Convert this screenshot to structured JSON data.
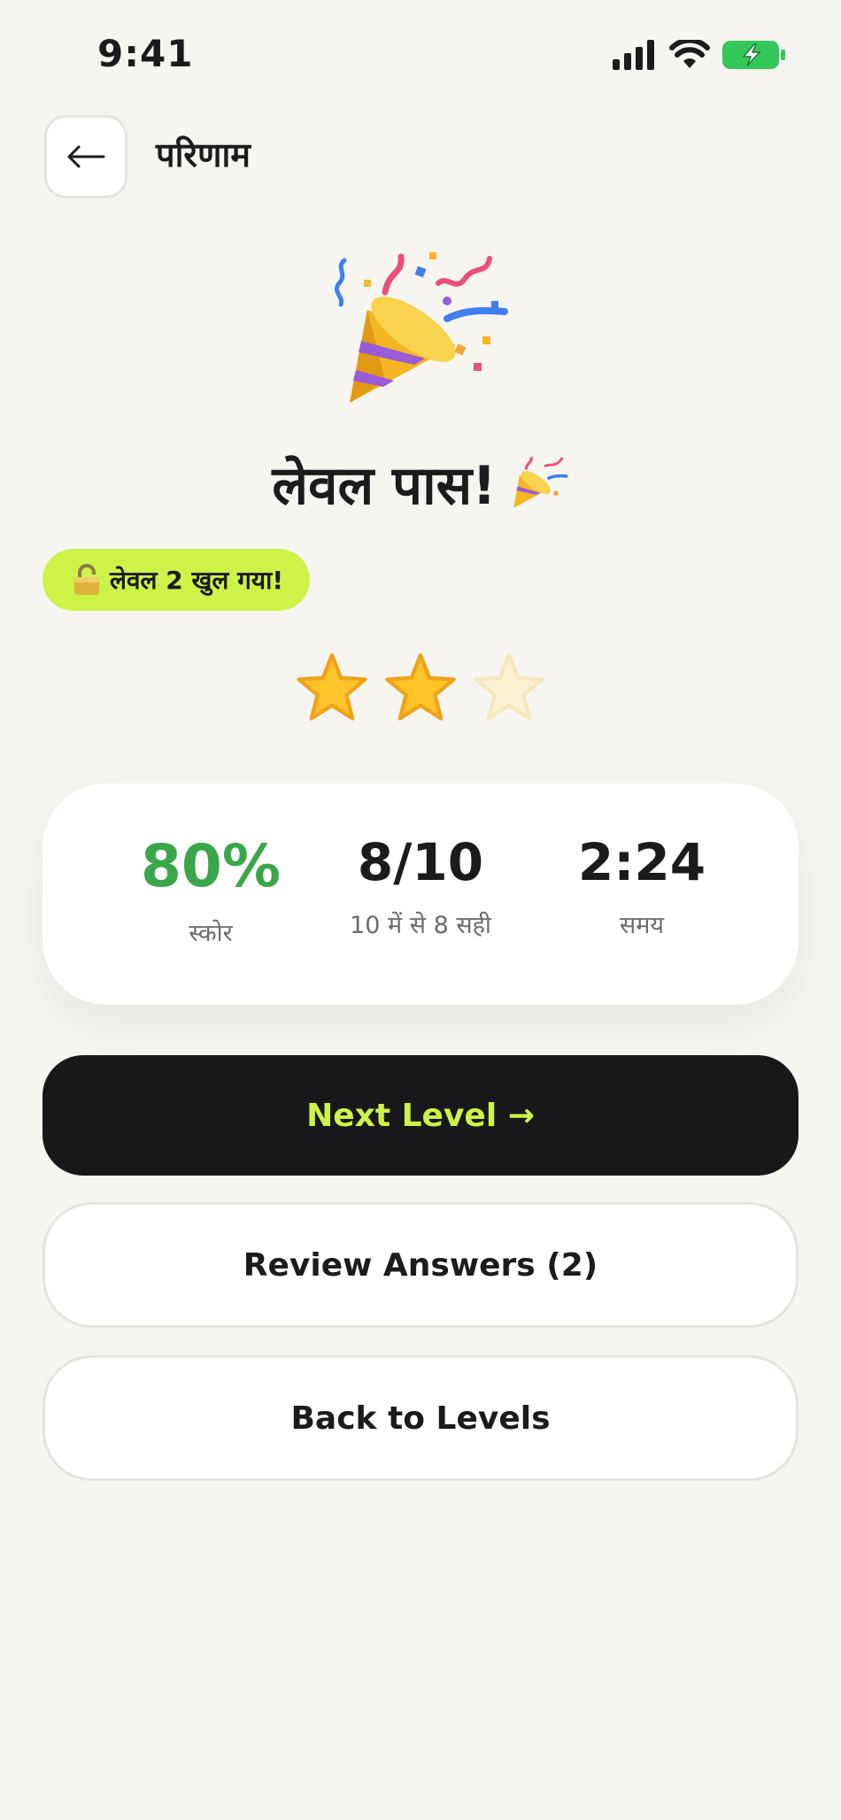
{
  "status_bar": {
    "time": "9:41"
  },
  "header": {
    "title": "परिणाम",
    "back_icon": "arrow-left-icon"
  },
  "result": {
    "title": "लेवल पास!",
    "unlock_badge": "लेवल 2 खुल गया!",
    "stars": {
      "earned": 2,
      "total": 3
    }
  },
  "stats": {
    "score": {
      "value": "80%",
      "label": "स्कोर"
    },
    "correct": {
      "value": "8/10",
      "label": "10 में से 8 सही"
    },
    "time": {
      "value": "2:24",
      "label": "समय"
    }
  },
  "actions": {
    "next_label": "Next Level →",
    "review_label": "Review Answers (2)",
    "back_label": "Back to Levels"
  },
  "colors": {
    "background": "#f6f5f0",
    "accent_lime": "#cdf348",
    "score_green": "#3aa64a",
    "dark_button": "#18181b",
    "battery_green": "#34c759",
    "star_gold": "#ffc32b"
  }
}
